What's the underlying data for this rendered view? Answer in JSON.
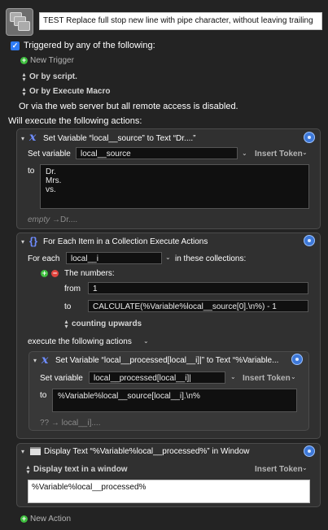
{
  "macro": {
    "name": "TEST Replace full stop new line with pipe character, without leaving trailing"
  },
  "triggers": {
    "checkbox_label": "Triggered by any of the following:",
    "new_trigger": "New Trigger",
    "or_by_script": "Or by script.",
    "or_by_execute_macro": "Or by Execute Macro",
    "web_server_note": "Or via the web server but all remote access is disabled."
  },
  "actions_heading": "Will execute the following actions:",
  "action1": {
    "title": "Set Variable “local__source” to Text “Dr....”",
    "set_variable_label": "Set variable",
    "variable_value": "local__source",
    "insert_token": "Insert Token",
    "to_label": "to",
    "text_lines": [
      "Dr.",
      "Mrs.",
      "vs."
    ],
    "preview_empty": "empty",
    "preview_arrow": "→",
    "preview_value": "Dr...."
  },
  "action2": {
    "title": "For Each Item in a Collection Execute Actions",
    "for_each_label": "For each",
    "variable_value": "local__i",
    "collections_label": "in these collections:",
    "collection_name": "The numbers:",
    "from_label": "from",
    "from_value": "1",
    "to_label": "to",
    "to_value": "CALCULATE(%Variable%local__source[0].\\n%) - 1",
    "counting_label": "counting upwards",
    "execute_label": "execute the following actions",
    "inner": {
      "title": "Set Variable “local__processed[local__i]|” to Text “%Variable...",
      "set_variable_label": "Set variable",
      "variable_value": "local__processed[local__i]|",
      "insert_token": "Insert Token",
      "to_label": "to",
      "text_value": "%Variable%local__source[local__i].\\n%",
      "preview": "?? → local__i]...."
    }
  },
  "action3": {
    "title": "Display Text “%Variable%local__processed%” in Window",
    "display_mode": "Display text in a window",
    "insert_token": "Insert Token",
    "text_value": "%Variable%local__processed%"
  },
  "new_action": "New Action",
  "colors": {
    "accent_blue": "#2f7cf6",
    "add_green": "#3fbf3f",
    "remove_red": "#e0443e",
    "background": "#232323"
  },
  "icons": [
    "macro-icon",
    "checkbox-icon",
    "plus-icon",
    "updown-icon",
    "variable-x-icon",
    "braces-icon",
    "display-window-icon",
    "gear-icon",
    "chevron-down-icon",
    "minus-icon"
  ]
}
